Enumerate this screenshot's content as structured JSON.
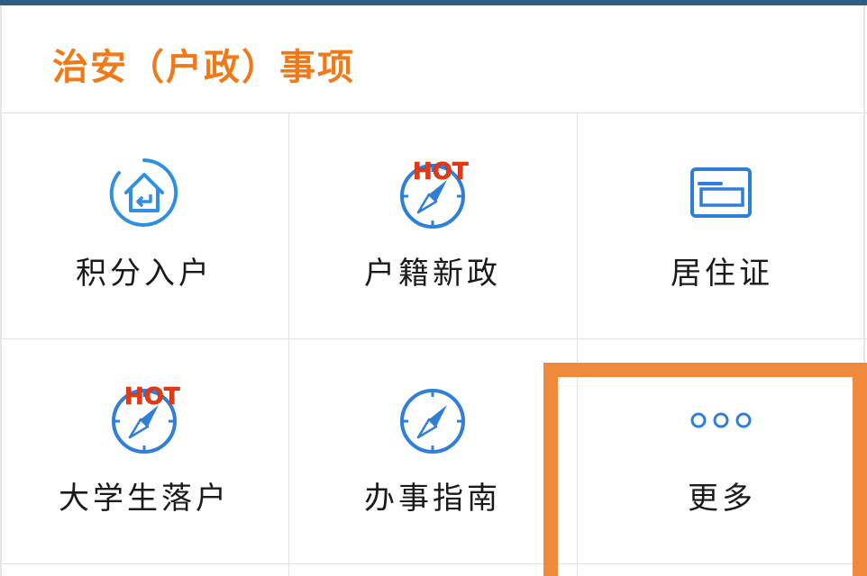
{
  "header": {
    "title": "治安（户政）事项"
  },
  "colors": {
    "accent_orange": "#f07a18",
    "icon_blue": "#2f7fd8",
    "hot_red": "#e23a14",
    "top_bar": "#2f5d86",
    "highlight": "#f08a3a"
  },
  "items": [
    {
      "label": "积分入户",
      "icon": "home-return-icon",
      "hot": false
    },
    {
      "label": "户籍新政",
      "icon": "compass-icon",
      "hot": true,
      "hot_text": "HOT"
    },
    {
      "label": "居住证",
      "icon": "id-card-icon",
      "hot": false
    },
    {
      "label": "大学生落户",
      "icon": "compass-icon",
      "hot": true,
      "hot_text": "HOT"
    },
    {
      "label": "办事指南",
      "icon": "compass-icon",
      "hot": false
    },
    {
      "label": "更多",
      "icon": "more-dots-icon",
      "hot": false
    }
  ]
}
